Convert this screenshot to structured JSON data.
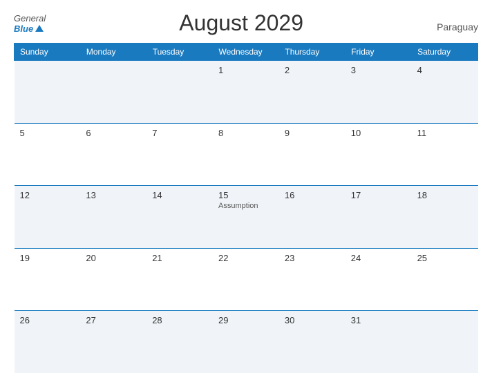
{
  "header": {
    "logo_general": "General",
    "logo_blue": "Blue",
    "title": "August 2029",
    "country": "Paraguay"
  },
  "weekdays": [
    "Sunday",
    "Monday",
    "Tuesday",
    "Wednesday",
    "Thursday",
    "Friday",
    "Saturday"
  ],
  "weeks": [
    [
      {
        "day": "",
        "event": ""
      },
      {
        "day": "",
        "event": ""
      },
      {
        "day": "",
        "event": ""
      },
      {
        "day": "1",
        "event": ""
      },
      {
        "day": "2",
        "event": ""
      },
      {
        "day": "3",
        "event": ""
      },
      {
        "day": "4",
        "event": ""
      }
    ],
    [
      {
        "day": "5",
        "event": ""
      },
      {
        "day": "6",
        "event": ""
      },
      {
        "day": "7",
        "event": ""
      },
      {
        "day": "8",
        "event": ""
      },
      {
        "day": "9",
        "event": ""
      },
      {
        "day": "10",
        "event": ""
      },
      {
        "day": "11",
        "event": ""
      }
    ],
    [
      {
        "day": "12",
        "event": ""
      },
      {
        "day": "13",
        "event": ""
      },
      {
        "day": "14",
        "event": ""
      },
      {
        "day": "15",
        "event": "Assumption"
      },
      {
        "day": "16",
        "event": ""
      },
      {
        "day": "17",
        "event": ""
      },
      {
        "day": "18",
        "event": ""
      }
    ],
    [
      {
        "day": "19",
        "event": ""
      },
      {
        "day": "20",
        "event": ""
      },
      {
        "day": "21",
        "event": ""
      },
      {
        "day": "22",
        "event": ""
      },
      {
        "day": "23",
        "event": ""
      },
      {
        "day": "24",
        "event": ""
      },
      {
        "day": "25",
        "event": ""
      }
    ],
    [
      {
        "day": "26",
        "event": ""
      },
      {
        "day": "27",
        "event": ""
      },
      {
        "day": "28",
        "event": ""
      },
      {
        "day": "29",
        "event": ""
      },
      {
        "day": "30",
        "event": ""
      },
      {
        "day": "31",
        "event": ""
      },
      {
        "day": "",
        "event": ""
      }
    ]
  ]
}
